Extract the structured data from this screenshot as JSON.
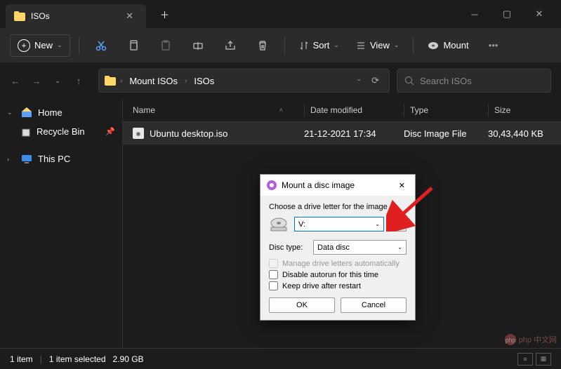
{
  "window": {
    "tab_title": "ISOs",
    "new_label": "New",
    "sort_label": "Sort",
    "view_label": "View",
    "mount_label": "Mount"
  },
  "breadcrumb": {
    "seg1": "Mount ISOs",
    "seg2": "ISOs"
  },
  "search": {
    "placeholder": "Search ISOs"
  },
  "sidebar": {
    "home": "Home",
    "recycle": "Recycle Bin",
    "thispc": "This PC"
  },
  "columns": {
    "name": "Name",
    "date": "Date modified",
    "type": "Type",
    "size": "Size"
  },
  "files": [
    {
      "name": "Ubuntu desktop.iso",
      "date": "21-12-2021 17:34",
      "type": "Disc Image File",
      "size": "30,43,440 KB"
    }
  ],
  "status": {
    "count": "1 item",
    "selected": "1 item selected",
    "size": "2.90 GB"
  },
  "dialog": {
    "title": "Mount a disc image",
    "instruction": "Choose a drive letter for the image",
    "drive_value": "V:",
    "disc_type_label": "Disc type:",
    "disc_type_value": "Data disc",
    "chk_manage": "Manage drive letters automatically",
    "chk_autorun": "Disable autorun for this time",
    "chk_keep": "Keep drive after restart",
    "ok": "OK",
    "cancel": "Cancel"
  },
  "watermark": "php 中文网"
}
